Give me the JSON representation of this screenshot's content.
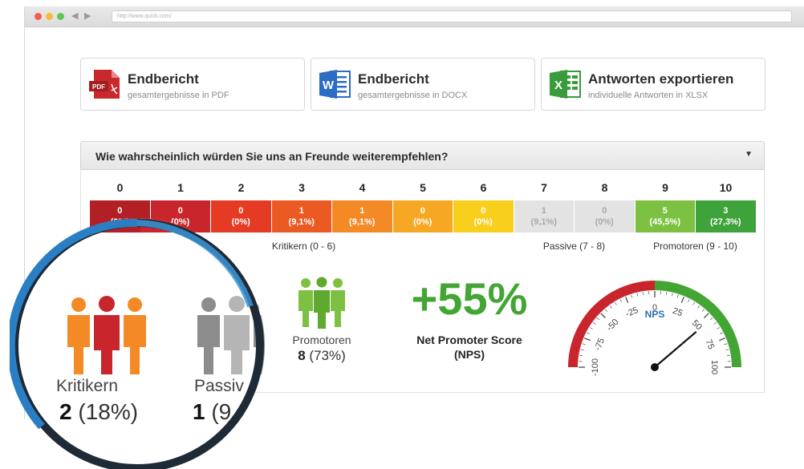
{
  "browser": {
    "url": "http://www.quick.com/"
  },
  "exports": [
    {
      "title": "Endbericht",
      "subtitle": "gesamtergebnisse in PDF",
      "icon": "pdf-icon",
      "color": "#c9282d",
      "icon_text": "PDF"
    },
    {
      "title": "Endbericht",
      "subtitle": "gesamtergebnisse in DOCX",
      "icon": "word-icon",
      "color": "#2b6cc4",
      "icon_text": "W"
    },
    {
      "title": "Antworten exportieren",
      "subtitle": "individuelle Antworten in XLSX",
      "icon": "excel-icon",
      "color": "#3a9b3a",
      "icon_text": "X"
    }
  ],
  "question": {
    "text": "Wie wahrscheinlich würden Sie uns an Freunde weiterempfehlen?"
  },
  "scale": [
    {
      "n": "0",
      "count": "0",
      "pct": "(0%)",
      "color": "#b21f24"
    },
    {
      "n": "1",
      "count": "0",
      "pct": "(0%)",
      "color": "#c8262c"
    },
    {
      "n": "2",
      "count": "0",
      "pct": "(0%)",
      "color": "#e53a24"
    },
    {
      "n": "3",
      "count": "1",
      "pct": "(9,1%)",
      "color": "#ec5a24"
    },
    {
      "n": "4",
      "count": "1",
      "pct": "(9,1%)",
      "color": "#f38a26"
    },
    {
      "n": "5",
      "count": "0",
      "pct": "(0%)",
      "color": "#f6a825"
    },
    {
      "n": "6",
      "count": "0",
      "pct": "(0%)",
      "color": "#f8cf1d"
    },
    {
      "n": "7",
      "count": "1",
      "pct": "(9,1%)",
      "color": "#e3e3e3"
    },
    {
      "n": "8",
      "count": "0",
      "pct": "(0%)",
      "color": "#e3e3e3"
    },
    {
      "n": "9",
      "count": "5",
      "pct": "(45,5%)",
      "color": "#7dc142"
    },
    {
      "n": "10",
      "count": "3",
      "pct": "(27,3%)",
      "color": "#3ea33a"
    }
  ],
  "groups": {
    "detractors": "Kritikern (0 - 6)",
    "passives": "Passive (7 - 8)",
    "promoters": "Promotoren (9 - 10)"
  },
  "stats": {
    "promoters_label": "Promotoren",
    "promoters_count": "8",
    "promoters_pct": "(73%)",
    "nps_value": "+55%",
    "nps_label": "Net Promoter Score",
    "nps_abbr": "(NPS)"
  },
  "magnifier": {
    "kritikern_label": "Kritikern",
    "kritikern_count": "2",
    "kritikern_pct": "(18%)",
    "passive_label": "Passiv",
    "passive_count": "1",
    "passive_pct": "(9"
  },
  "gauge": {
    "label": "NPS",
    "value": 55,
    "ticks": [
      "-100",
      "-75",
      "-50",
      "-25",
      "0",
      "25",
      "50",
      "75",
      "100"
    ]
  },
  "colors": {
    "promoter_green": "#7dc142",
    "detractor_red": "#c8262c",
    "detractor_orange": "#f38a26",
    "passive_gray": "#a9a9a9",
    "nps_green": "#43a533",
    "ring_blue": "#2a7fc4",
    "ring_dark": "#1e2a36"
  }
}
